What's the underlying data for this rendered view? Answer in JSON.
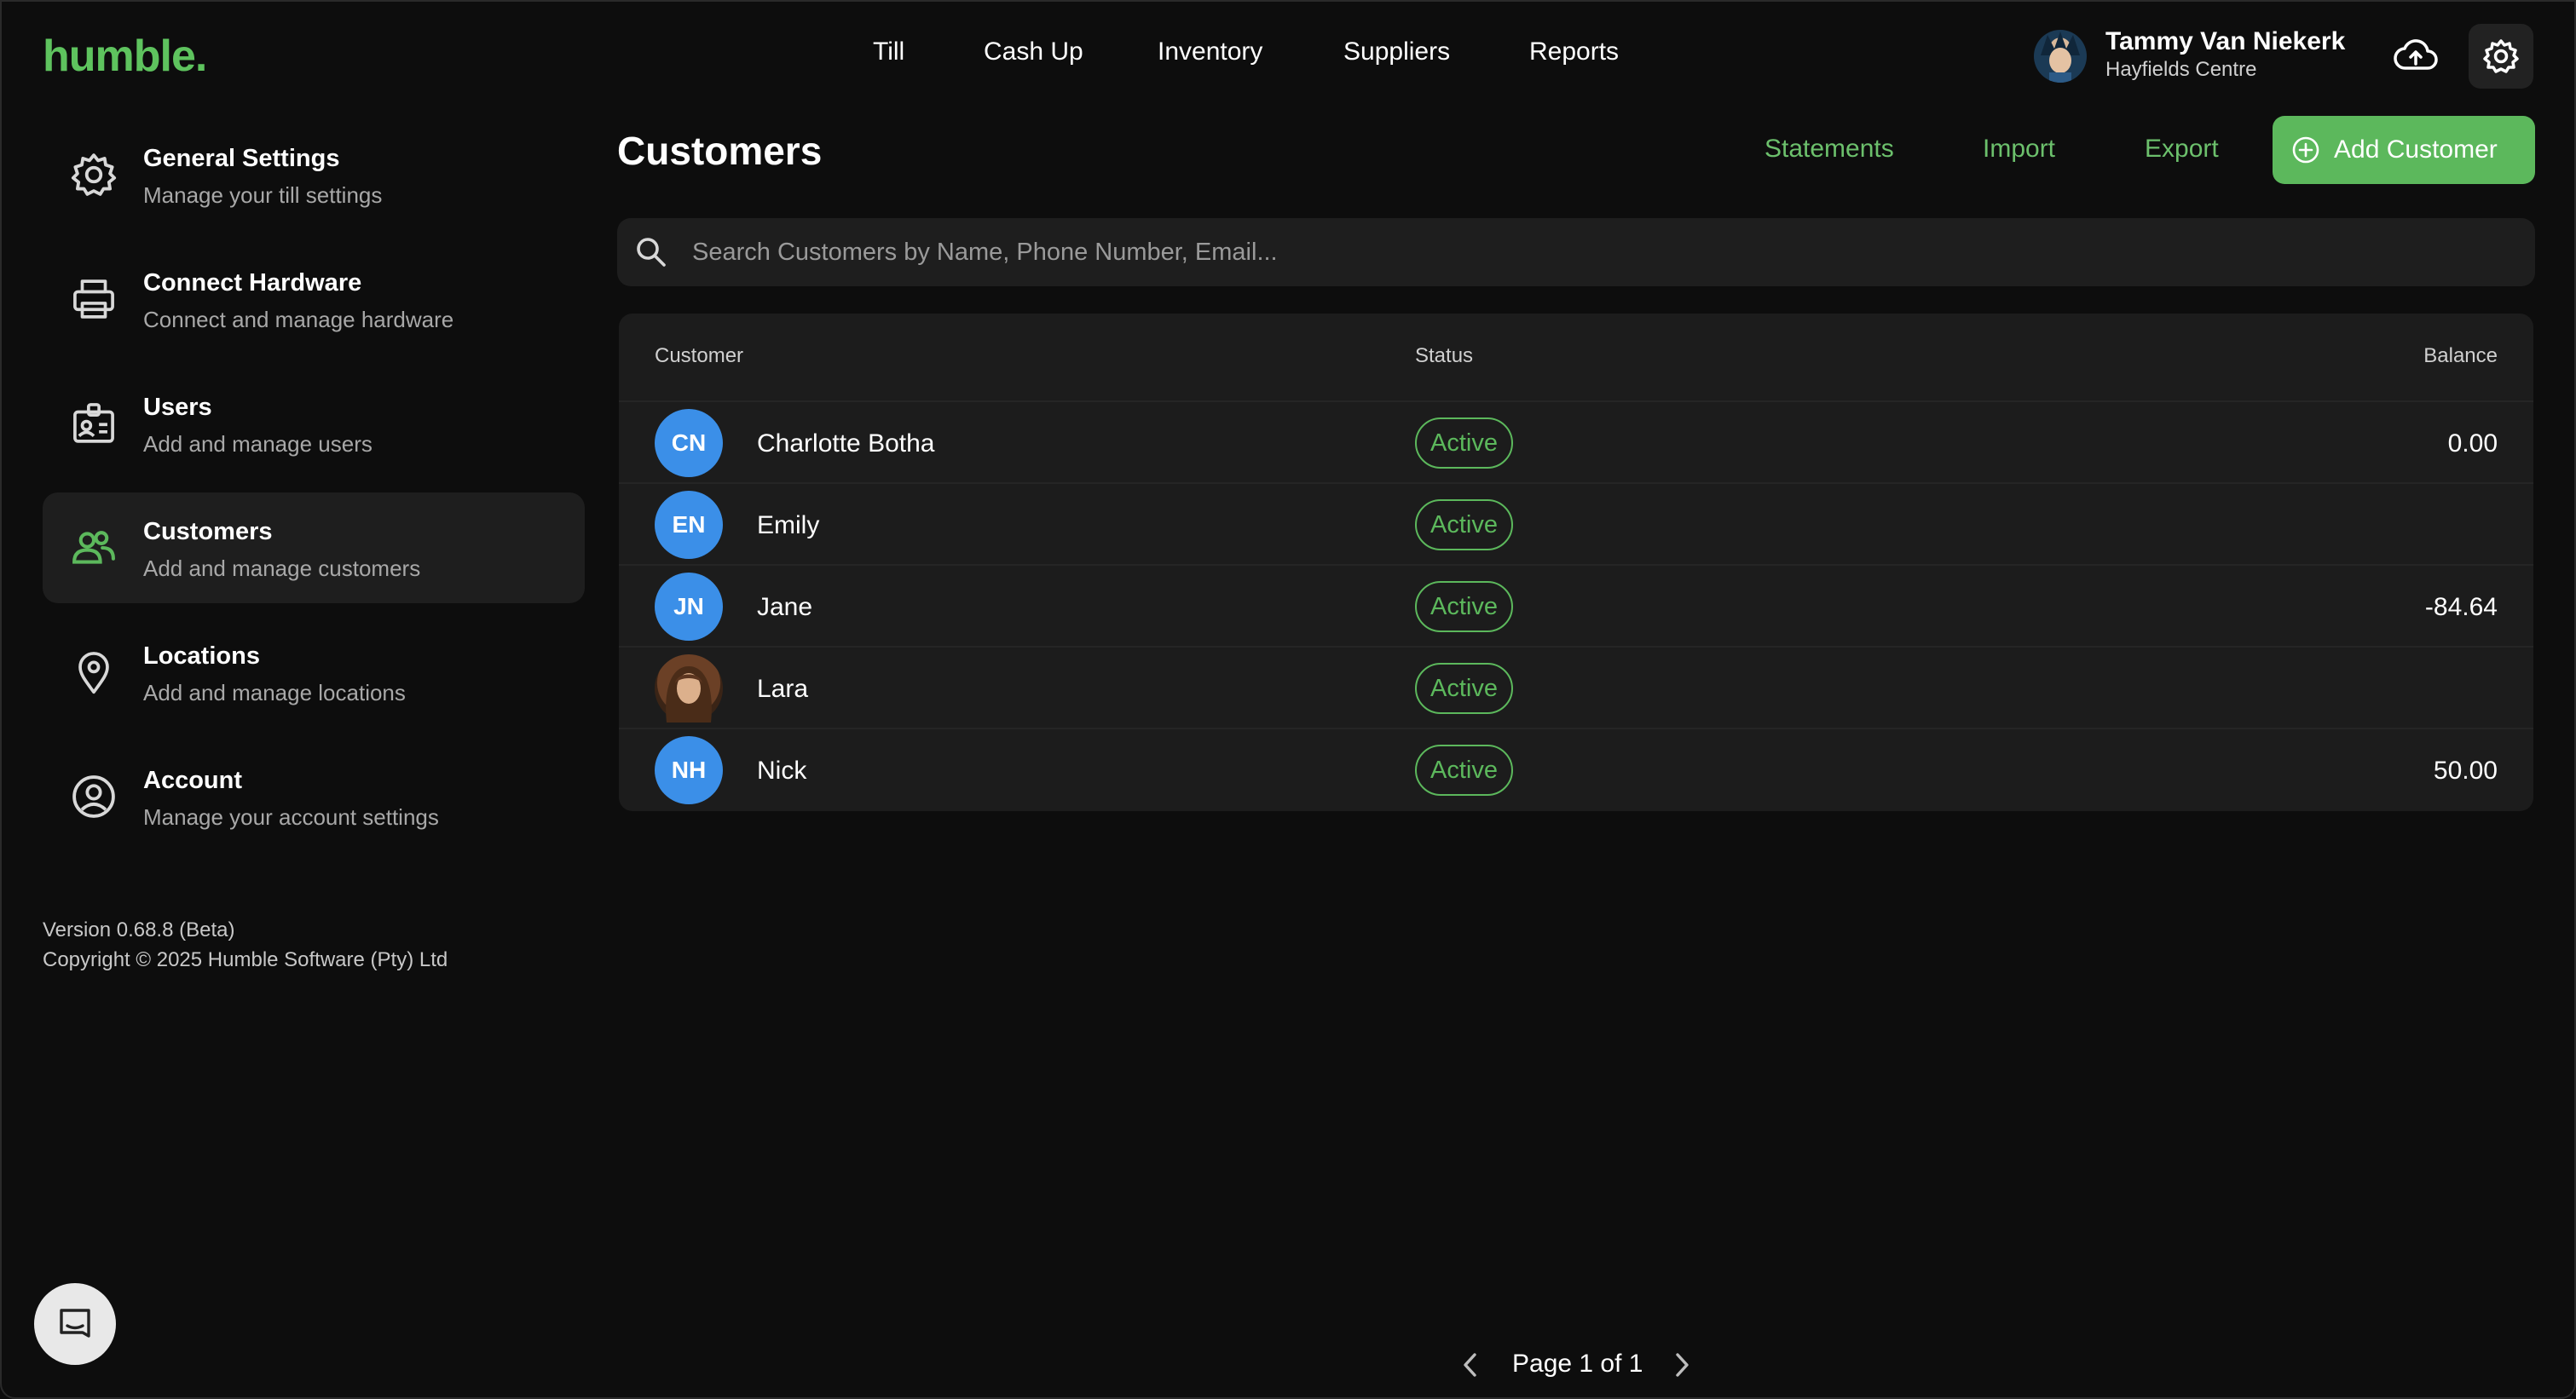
{
  "app": {
    "logo": "humble."
  },
  "topnav": [
    "Till",
    "Cash Up",
    "Inventory",
    "Suppliers",
    "Reports"
  ],
  "user": {
    "name": "Tammy Van Niekerk",
    "location": "Hayfields Centre"
  },
  "sidebar": {
    "items": [
      {
        "title": "General Settings",
        "subtitle": "Manage your till settings",
        "icon": "gear-icon"
      },
      {
        "title": "Connect Hardware",
        "subtitle": "Connect and manage hardware",
        "icon": "printer-icon"
      },
      {
        "title": "Users",
        "subtitle": "Add and manage users",
        "icon": "id-card-icon"
      },
      {
        "title": "Customers",
        "subtitle": "Add and manage customers",
        "icon": "people-icon",
        "active": true
      },
      {
        "title": "Locations",
        "subtitle": "Add and manage locations",
        "icon": "map-pin-icon"
      },
      {
        "title": "Account",
        "subtitle": "Manage your account settings",
        "icon": "user-circle-icon"
      }
    ],
    "version": "Version 0.68.8 (Beta)",
    "copyright": "Copyright © 2025 Humble Software (Pty) Ltd"
  },
  "main": {
    "title": "Customers",
    "actions": {
      "statements": "Statements",
      "import": "Import",
      "export": "Export",
      "add": "Add Customer"
    },
    "search": {
      "placeholder": "Search Customers by Name, Phone Number, Email...",
      "value": ""
    },
    "table": {
      "headers": {
        "customer": "Customer",
        "status": "Status",
        "balance": "Balance"
      },
      "rows": [
        {
          "initials": "CN",
          "name": "Charlotte Botha",
          "status": "Active",
          "balance": "0.00"
        },
        {
          "initials": "EN",
          "name": "Emily",
          "status": "Active",
          "balance": ""
        },
        {
          "initials": "JN",
          "name": "Jane",
          "status": "Active",
          "balance": "-84.64"
        },
        {
          "initials": "",
          "name": "Lara",
          "status": "Active",
          "balance": "",
          "photo": true
        },
        {
          "initials": "NH",
          "name": "Nick",
          "status": "Active",
          "balance": "50.00"
        }
      ]
    },
    "pagination": {
      "label": "Page 1 of 1"
    }
  },
  "colors": {
    "accent": "#5cb85c",
    "avatar": "#3b8fe8",
    "background": "#0d0d0d",
    "surface": "#1c1c1c"
  }
}
